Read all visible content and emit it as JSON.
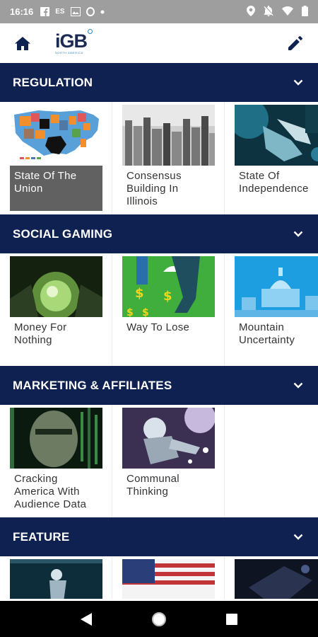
{
  "status_bar": {
    "time": "16:16",
    "left_icons": [
      "facebook-icon",
      "es-text",
      "image-icon",
      "opera-icon",
      "dot-icon"
    ],
    "es_label": "ES",
    "right_icons": [
      "location-icon",
      "mute-icon",
      "wifi-icon",
      "battery-icon"
    ]
  },
  "app_bar": {
    "logo_text": "iGB",
    "logo_sub": "NORTH AMERICA",
    "home_icon": "home-icon",
    "edit_icon": "edit-icon"
  },
  "sections": [
    {
      "title": "REGULATION",
      "cards": [
        {
          "label": "State Of The Union",
          "image": "us-map-image",
          "selected": true
        },
        {
          "label": "Consensus Building In Illinois",
          "image": "city-skyline-image"
        },
        {
          "label": "State Of Independence",
          "image": "robot-hand-image"
        }
      ]
    },
    {
      "title": "SOCIAL GAMING",
      "cards": [
        {
          "label": "Money For Nothing",
          "image": "glowing-orb-image"
        },
        {
          "label": "Way To Lose",
          "image": "dollar-legs-image"
        },
        {
          "label": "Mountain Uncertainty",
          "image": "capitol-image"
        }
      ]
    },
    {
      "title": "MARKETING & AFFILIATES",
      "cards": [
        {
          "label": "Cracking America With Audience Data",
          "image": "matrix-face-image"
        },
        {
          "label": "Communal Thinking",
          "image": "robot-player-image"
        }
      ]
    },
    {
      "title": "FEATURE",
      "cards": [
        {
          "label": "",
          "image": "baseball-image"
        },
        {
          "label": "",
          "image": "us-flag-image"
        },
        {
          "label": "",
          "image": "dark-tech-image"
        }
      ]
    }
  ],
  "nav_bar": {
    "back_icon": "back-icon",
    "home_icon": "circle-home-icon",
    "recents_icon": "recents-icon"
  },
  "colors": {
    "header_navy": "#0f2150",
    "status_gray": "#9e9e9e",
    "selected_gray": "#616161",
    "logo_navy": "#1a2a52",
    "logo_blue": "#2d87c4"
  }
}
